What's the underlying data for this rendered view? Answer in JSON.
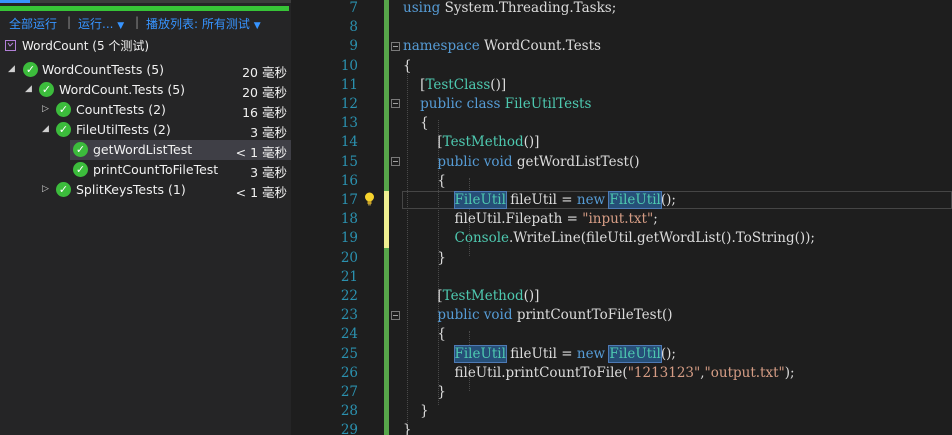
{
  "toolbar": {
    "run_all": "全部运行",
    "run": "运行...",
    "playlist": "播放列表: 所有测试"
  },
  "test_tree": {
    "root_label": "WordCount (5 个测试)",
    "items": [
      {
        "label": "WordCountTests (5)",
        "duration": "20 毫秒",
        "expanded": true
      },
      {
        "label": "WordCount.Tests (5)",
        "duration": "20 毫秒",
        "expanded": true
      },
      {
        "label": "CountTests (2)",
        "duration": "16 毫秒",
        "expanded": false
      },
      {
        "label": "FileUtilTests (2)",
        "duration": "3 毫秒",
        "expanded": true
      },
      {
        "label": "getWordListTest",
        "duration": "< 1 毫秒",
        "selected": true
      },
      {
        "label": "printCountToFileTest",
        "duration": "3 毫秒"
      },
      {
        "label": "SplitKeysTests (1)",
        "duration": "< 1 毫秒",
        "expanded": false
      }
    ]
  },
  "editor": {
    "line_numbers": [
      "7",
      "8",
      "9",
      "10",
      "11",
      "12",
      "13",
      "14",
      "15",
      "16",
      "17",
      "18",
      "19",
      "20",
      "21",
      "22",
      "23",
      "24",
      "25",
      "26",
      "27",
      "28",
      "29"
    ],
    "lines": {
      "l7": {
        "a": "using",
        "b": " System.Threading.Tasks;"
      },
      "l9": {
        "a": "namespace",
        "b": " WordCount.Tests"
      },
      "l10": "{",
      "l11": {
        "a": "    [",
        "b": "TestClass",
        "c": "()]"
      },
      "l12": {
        "a": "    public class ",
        "b": "FileUtilTests"
      },
      "l13": "    {",
      "l14": {
        "a": "        [",
        "b": "TestMethod",
        "c": "()]"
      },
      "l15": {
        "a": "        public void ",
        "b": "getWordListTest()"
      },
      "l16": "        {",
      "l17": {
        "a": "            ",
        "b": "FileUtil",
        "c": " fileUtil = ",
        "d": "new",
        "e": " ",
        "f": "FileUtil",
        "g": "();"
      },
      "l18": {
        "a": "            fileUtil.Filepath = ",
        "b": "\"input.txt\"",
        "c": ";"
      },
      "l19": {
        "a": "            ",
        "b": "Console",
        "c": ".WriteLine(fileUtil.getWordList().ToString());"
      },
      "l20": "        }",
      "l22": {
        "a": "        [",
        "b": "TestMethod",
        "c": "()]"
      },
      "l23": {
        "a": "        public void ",
        "b": "printCountToFileTest()"
      },
      "l24": "        {",
      "l25": {
        "a": "            ",
        "b": "FileUtil",
        "c": " fileUtil = ",
        "d": "new",
        "e": " ",
        "f": "FileUtil",
        "g": "();"
      },
      "l26": {
        "a": "            fileUtil.printCountToFile(",
        "b": "\"1213123\"",
        "c": ",",
        "d": "\"output.txt\"",
        "e": ");"
      },
      "l27": "        }",
      "l28": "    }",
      "l29": "}"
    }
  },
  "colors": {
    "progress": "#37c437",
    "pass": "#3cbc3c",
    "keyword": "#569cd6",
    "type": "#4ec9b0",
    "string": "#d69d85",
    "line_number": "#2b91af",
    "change_bar_saved": "#57a64a",
    "change_bar_unsaved": "#efef91"
  }
}
